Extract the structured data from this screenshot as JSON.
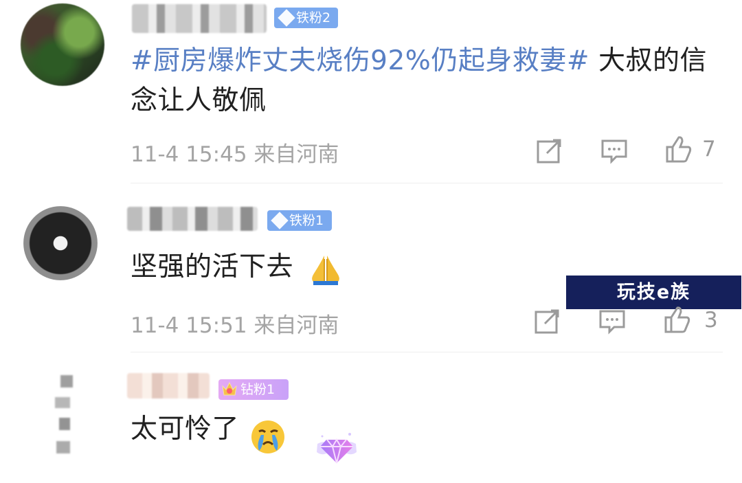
{
  "comments": [
    {
      "badge": "铁粉2",
      "hashtag": "#厨房爆炸丈夫烧伤92%仍起身救妻#",
      "body": " 大叔的信念让人敬佩",
      "meta": "11-4 15:45 来自河南",
      "like_count": "7"
    },
    {
      "badge": "铁粉1",
      "body": "坚强的活下去",
      "meta": "11-4 15:51 来自河南",
      "like_count": "3",
      "watermark": "玩技e族"
    },
    {
      "badge": "钻粉1",
      "body": "太可怜了"
    }
  ],
  "icons": {
    "share": "share-edit-icon",
    "comment": "comment-icon",
    "like": "thumb-up-icon",
    "pray": "folded-hands-emoji",
    "cry": "crying-face-emoji",
    "gem": "gem-icon"
  },
  "colors": {
    "hashtag": "#587fc4",
    "iron_badge": "#7aa9ef",
    "diamond_badge": "#d9a8f6",
    "watermark_bg": "#15205b"
  }
}
